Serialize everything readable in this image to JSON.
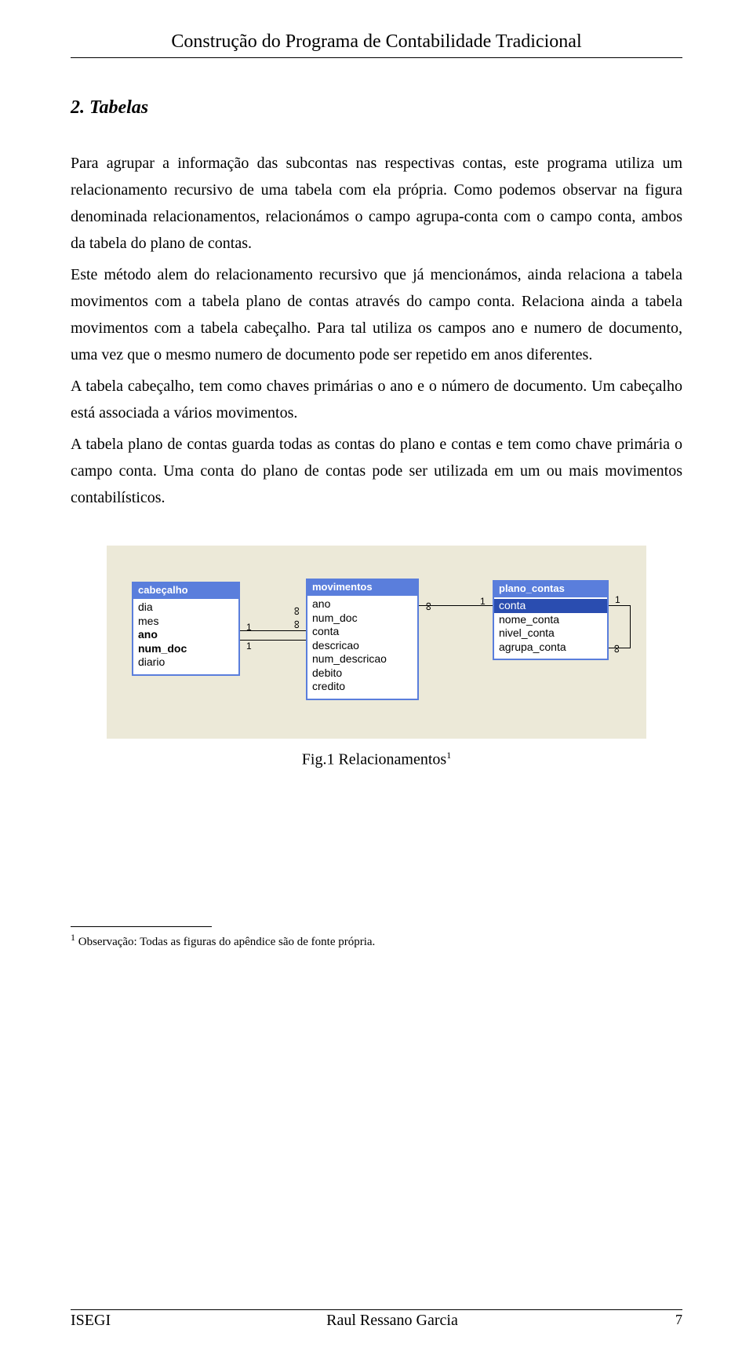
{
  "header": {
    "title": "Construção do Programa de Contabilidade Tradicional"
  },
  "section": {
    "title": "2. Tabelas"
  },
  "paragraphs": {
    "p1": "Para agrupar a informação das subcontas nas respectivas contas, este programa utiliza um relacionamento recursivo de uma tabela com ela própria. Como podemos observar na figura denominada relacionamentos, relacionámos o campo agrupa-conta com o campo conta, ambos da tabela do plano de contas.",
    "p2": "Este método alem do relacionamento recursivo que já mencionámos, ainda relaciona a tabela movimentos com a tabela plano de contas através do campo conta. Relaciona ainda a tabela movimentos com a tabela cabeçalho. Para tal utiliza os campos ano e numero de documento, uma vez que o mesmo numero de documento pode ser repetido em anos diferentes.",
    "p3": "A tabela cabeçalho, tem como chaves primárias o ano e o número de documento. Um cabeçalho está associada a vários movimentos.",
    "p4": "A tabela plano de contas guarda todas as contas do plano e contas e tem como chave primária o campo conta. Uma conta do plano de contas pode ser utilizada em um ou mais movimentos contabilísticos."
  },
  "diagram": {
    "tables": {
      "cabecalho": {
        "title": "cabeçalho",
        "fields": [
          "dia",
          "mes",
          "ano",
          "num_doc",
          "diario"
        ],
        "bold_fields": [
          "ano",
          "num_doc"
        ]
      },
      "movimentos": {
        "title": "movimentos",
        "fields": [
          "ano",
          "num_doc",
          "conta",
          "descricao",
          "num_descricao",
          "debito",
          "credito"
        ]
      },
      "plano_contas": {
        "title": "plano_contas",
        "fields": [
          "conta",
          "nome_conta",
          "nivel_conta",
          "agrupa_conta"
        ],
        "pk_fields": [
          "conta"
        ]
      }
    },
    "cardinalities": {
      "one": "1",
      "many": "∞"
    }
  },
  "caption": {
    "text": "Fig.1 Relacionamentos",
    "mark": "1"
  },
  "footnote": {
    "mark": "1",
    "text": " Observação: Todas as figuras do apêndice são de fonte própria."
  },
  "footer": {
    "left": "ISEGI",
    "center": "Raul Ressano Garcia",
    "pagenum": "7"
  }
}
